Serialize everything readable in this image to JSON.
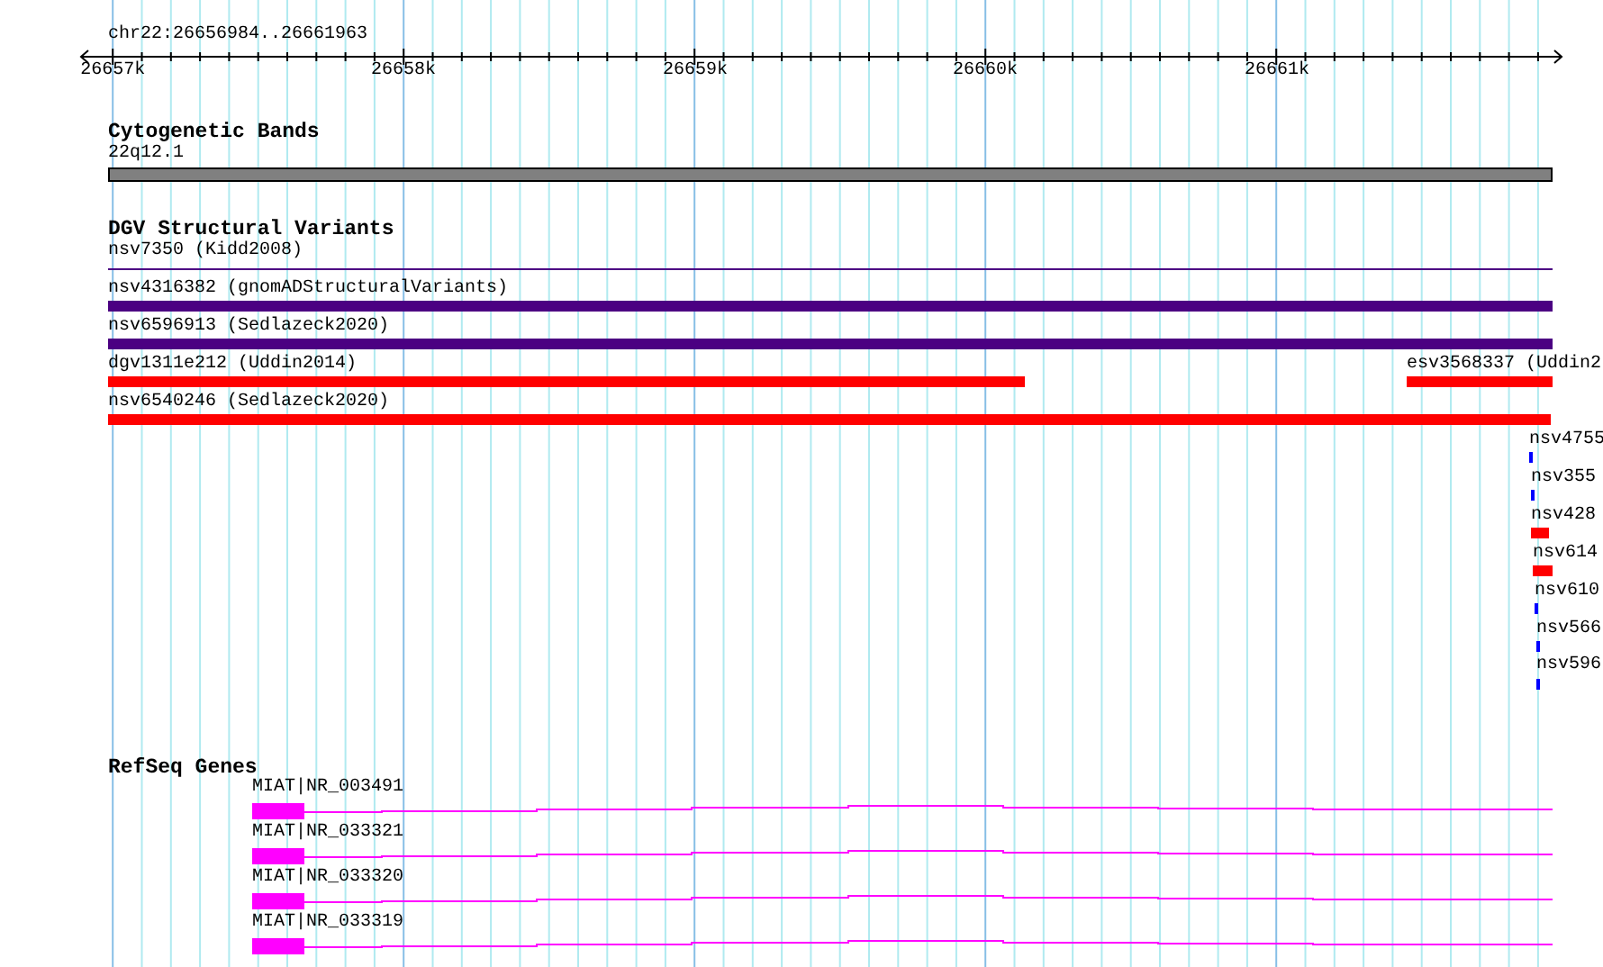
{
  "locus": "chr22:26656984..26661963",
  "ruler": {
    "ticks": [
      "26657k",
      "26658k",
      "26659k",
      "26660k",
      "26661k"
    ]
  },
  "cytoband": {
    "title": "Cytogenetic Bands",
    "band": "22q12.1",
    "color": "#808080"
  },
  "dgv": {
    "title": "DGV Structural Variants",
    "features": [
      {
        "label": "nsv7350 (Kidd2008)",
        "kind": "line",
        "color": "#4b0082"
      },
      {
        "label": "nsv4316382 (gnomADStructuralVariants)",
        "kind": "bar",
        "color": "#4b0082"
      },
      {
        "label": "nsv6596913 (Sedlazeck2020)",
        "kind": "bar",
        "color": "#4b0082"
      },
      {
        "label": "dgv1311e212 (Uddin2014)",
        "kind": "bar",
        "color": "#ff0000"
      },
      {
        "label": "esv3568337 (Uddin2",
        "kind": "bar",
        "color": "#ff0000"
      },
      {
        "label": "nsv6540246 (Sedlazeck2020)",
        "kind": "bar",
        "color": "#ff0000"
      },
      {
        "label": "nsv4755",
        "kind": "bar",
        "color": "#0000ff"
      },
      {
        "label": "nsv355",
        "kind": "bar",
        "color": "#0000ff"
      },
      {
        "label": "nsv428",
        "kind": "bar",
        "color": "#ff0000"
      },
      {
        "label": "nsv614",
        "kind": "bar",
        "color": "#ff0000"
      },
      {
        "label": "nsv610",
        "kind": "bar",
        "color": "#0000ff"
      },
      {
        "label": "nsv566",
        "kind": "bar",
        "color": "#0000ff"
      },
      {
        "label": "nsv596",
        "kind": "bar",
        "color": "#0000ff"
      }
    ]
  },
  "refseq": {
    "title": "RefSeq Genes",
    "genes": [
      {
        "label": "MIAT|NR_003491"
      },
      {
        "label": "MIAT|NR_033321"
      },
      {
        "label": "MIAT|NR_033320"
      },
      {
        "label": "MIAT|NR_033319"
      }
    ]
  }
}
